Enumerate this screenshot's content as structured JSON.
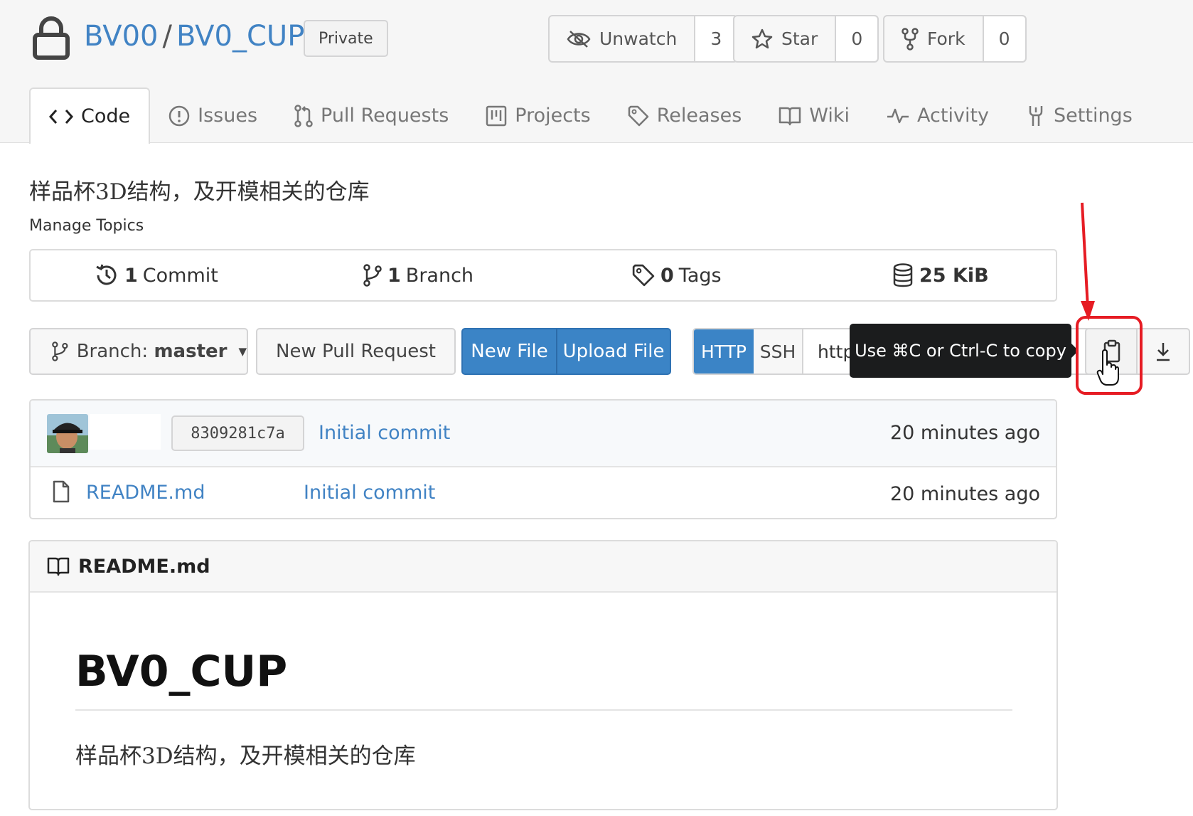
{
  "repo": {
    "owner": "BV00",
    "separator": "/",
    "name": "BV0_CUP",
    "visibility": "Private"
  },
  "actions": {
    "unwatch": {
      "label": "Unwatch",
      "count": "3"
    },
    "star": {
      "label": "Star",
      "count": "0"
    },
    "fork": {
      "label": "Fork",
      "count": "0"
    }
  },
  "tabs": [
    {
      "label": "Code",
      "icon": "code-icon",
      "active": true
    },
    {
      "label": "Issues",
      "icon": "issue-icon"
    },
    {
      "label": "Pull Requests",
      "icon": "pull-request-icon"
    },
    {
      "label": "Projects",
      "icon": "project-icon"
    },
    {
      "label": "Releases",
      "icon": "tag-icon"
    },
    {
      "label": "Wiki",
      "icon": "book-icon"
    },
    {
      "label": "Activity",
      "icon": "pulse-icon"
    },
    {
      "label": "Settings",
      "icon": "tools-icon"
    }
  ],
  "description": "样品杯3D结构，及开模相关的仓库",
  "manage_topics": "Manage Topics",
  "stats": {
    "commits": {
      "num": "1",
      "label": "Commit"
    },
    "branches": {
      "num": "1",
      "label": "Branch"
    },
    "tags": {
      "num": "0",
      "label": "Tags"
    },
    "size": {
      "num": "25 KiB",
      "label": ""
    }
  },
  "toolbar": {
    "branch_prefix": "Branch:",
    "branch_name": "master",
    "new_pull_request": "New Pull Request",
    "new_file": "New File",
    "upload_file": "Upload File",
    "http": "HTTP",
    "ssh": "SSH",
    "clone_url": "http:",
    "copy_tooltip": "Use ⌘C or Ctrl-C to copy"
  },
  "latest_commit": {
    "sha": "8309281c7a",
    "message": "Initial commit",
    "time": "20 minutes ago"
  },
  "files": [
    {
      "name": "README.md",
      "message": "Initial commit",
      "time": "20 minutes ago"
    }
  ],
  "readme": {
    "header": "README.md",
    "title": "BV0_CUP",
    "body": "样品杯3D结构，及开模相关的仓库"
  },
  "colors": {
    "link": "#4183c4",
    "primary_button": "#3b84c6",
    "annotation": "#e61c24"
  }
}
